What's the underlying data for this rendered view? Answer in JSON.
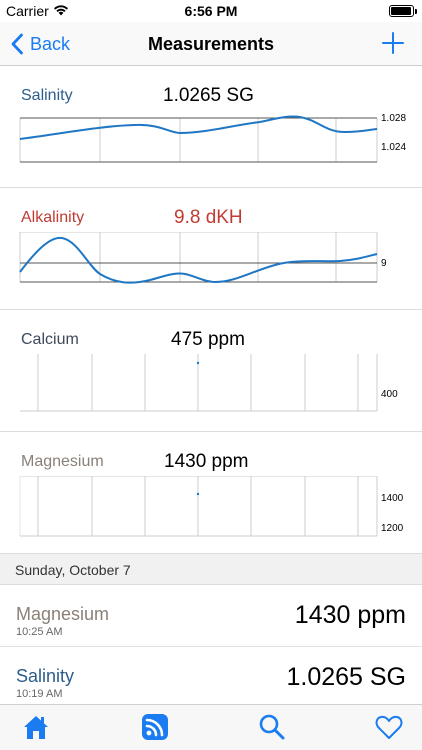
{
  "status_bar": {
    "carrier": "Carrier",
    "time": "6:56 PM",
    "wifi_icon": "wifi-icon",
    "battery_icon": "battery-icon"
  },
  "nav": {
    "back_label": "Back",
    "title": "Measurements",
    "add_icon": "plus-icon"
  },
  "colors": {
    "accent": "#1a7cf0",
    "salinity": "#2c5d8c",
    "alkalinity": "#c23b32",
    "calcium": "#3e4a5a",
    "magnesium": "#8a8078",
    "line": "#1f77c4",
    "ref_line": "#555555",
    "grid": "#cccccc"
  },
  "cards": [
    {
      "name": "Salinity",
      "value": "1.0265 SG",
      "y_ticks": [
        "1.028",
        "1.024"
      ]
    },
    {
      "name": "Alkalinity",
      "value": "9.8 dKH",
      "y_ticks": [
        "9"
      ]
    },
    {
      "name": "Calcium",
      "value": "475 ppm",
      "y_ticks": [
        "400"
      ]
    },
    {
      "name": "Magnesium",
      "value": "1430 ppm",
      "y_ticks": [
        "1400",
        "1200"
      ]
    }
  ],
  "section": {
    "header": "Sunday, October 7"
  },
  "log_entries": [
    {
      "name": "Magnesium",
      "time": "10:25 AM",
      "value": "1430 ppm"
    },
    {
      "name": "Salinity",
      "time": "10:19 AM",
      "value": "1.0265 SG"
    }
  ],
  "tab_bar": {
    "items": [
      "home-icon",
      "feed-icon",
      "search-icon",
      "heart-icon"
    ]
  }
}
